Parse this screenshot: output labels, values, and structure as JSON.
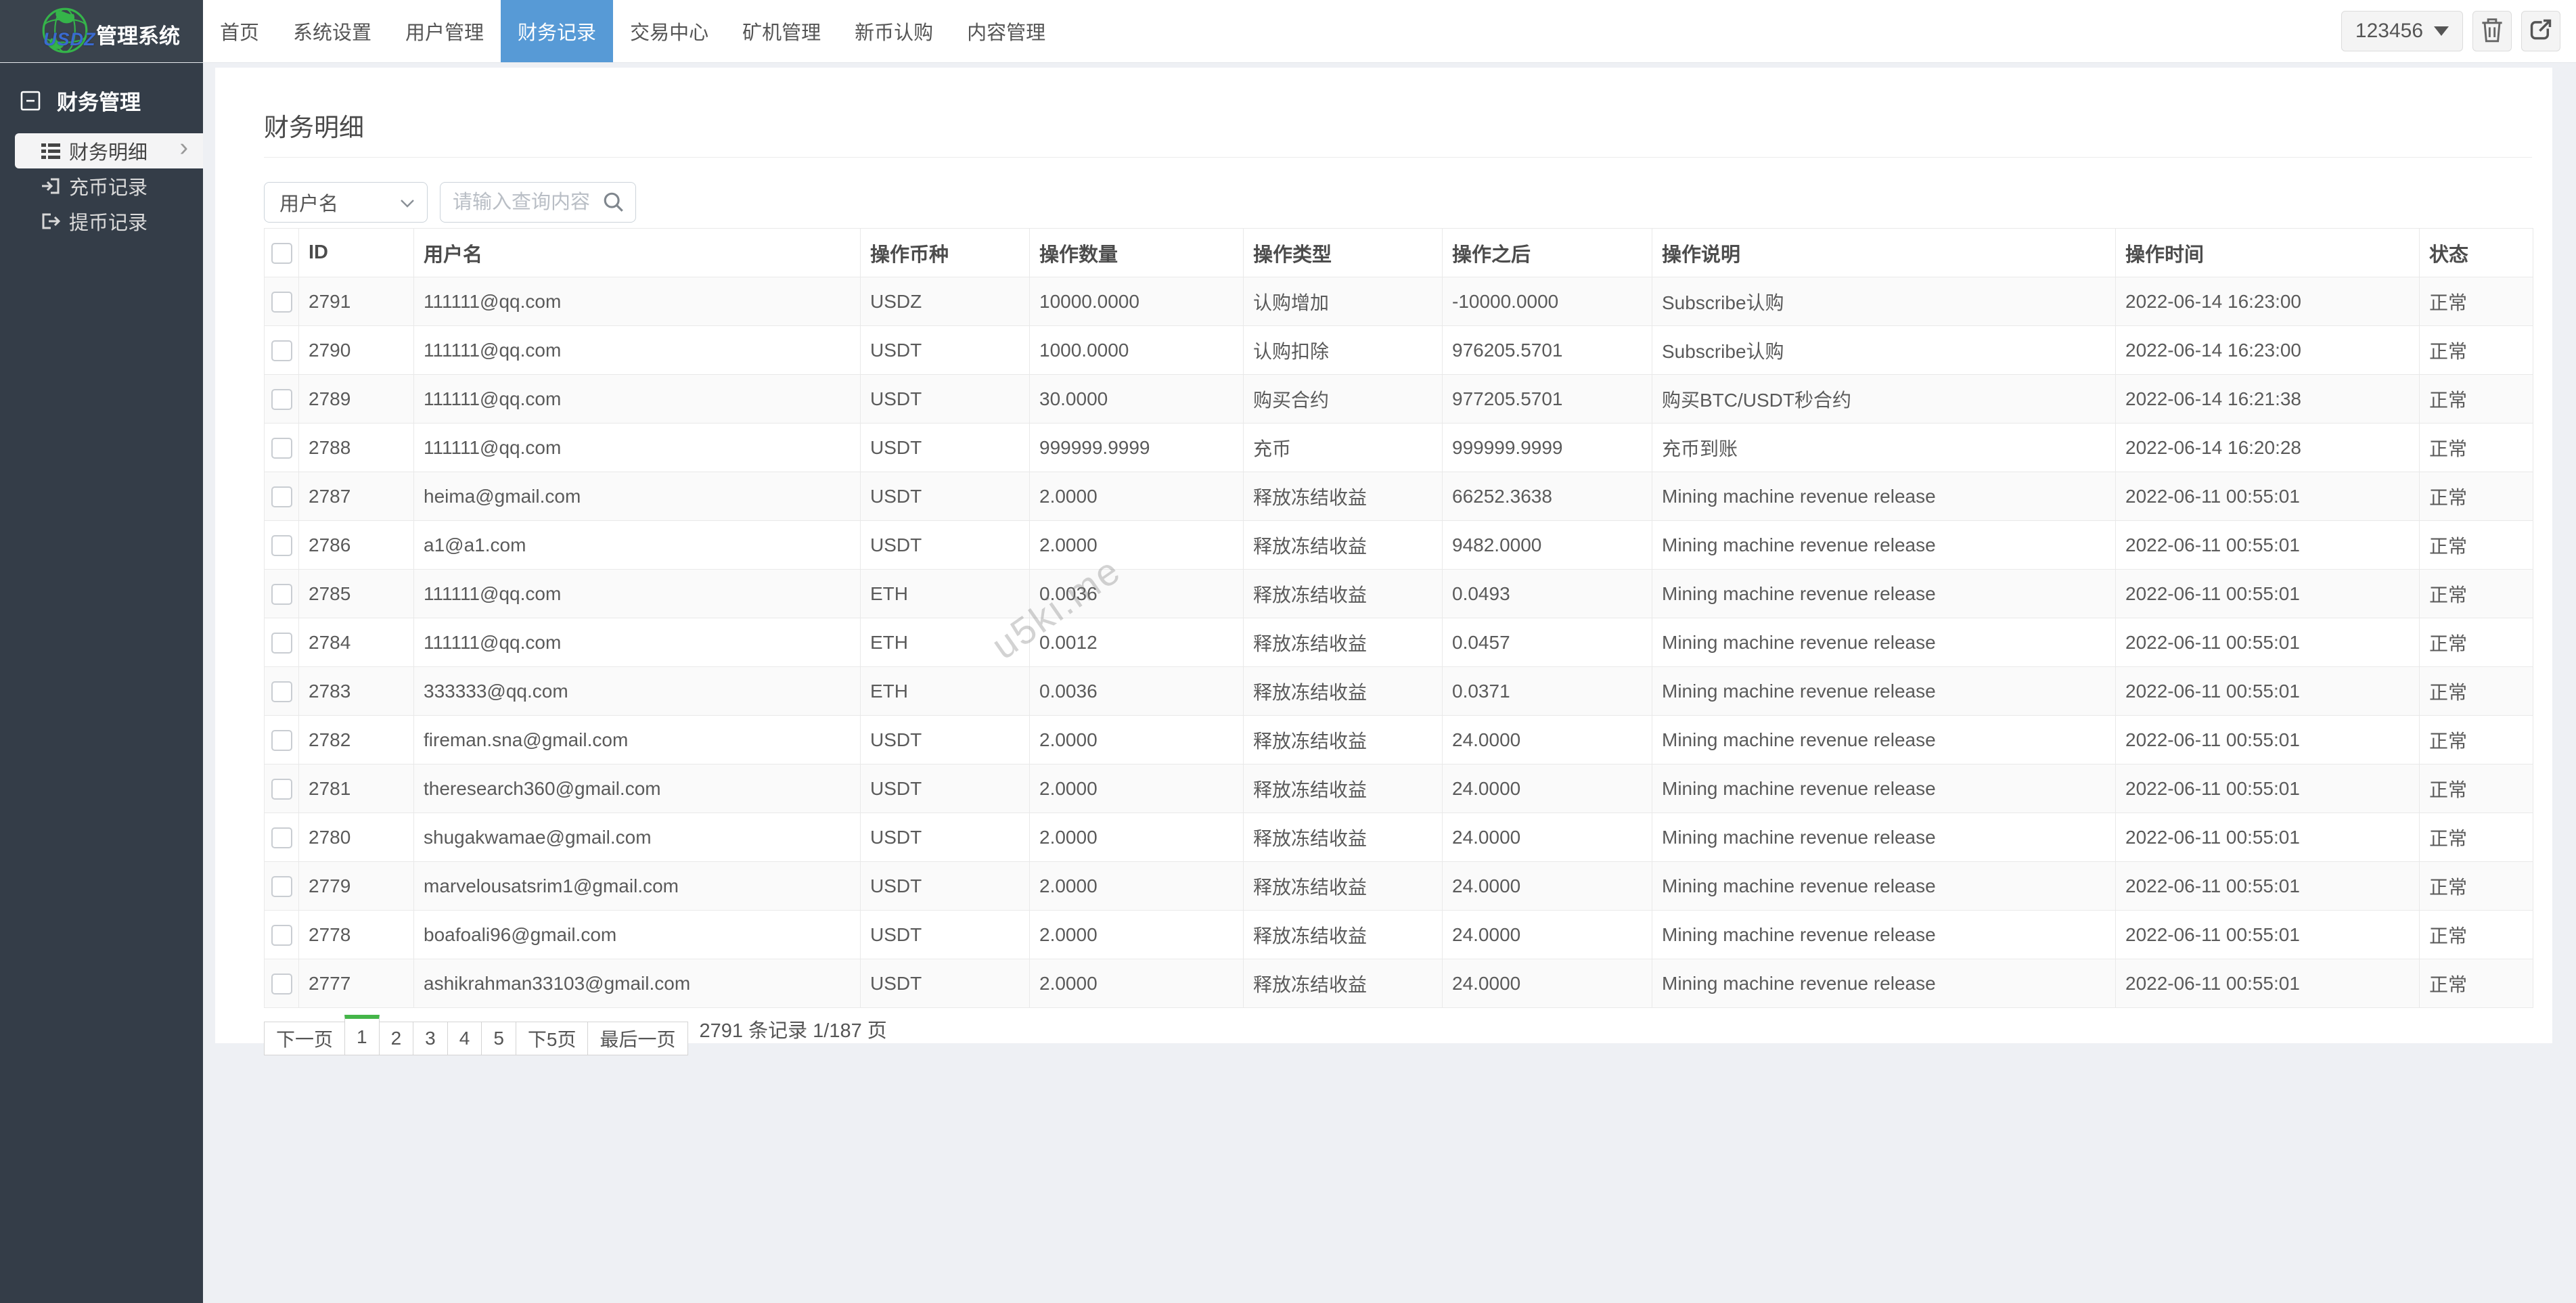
{
  "navbar": {
    "brand": {
      "logo_text": "USDZ",
      "title": "管理系统"
    },
    "items": [
      {
        "name": "home",
        "label": "首页",
        "active": false
      },
      {
        "name": "system-settings",
        "label": "系统设置",
        "active": false
      },
      {
        "name": "user-management",
        "label": "用户管理",
        "active": false
      },
      {
        "name": "finance-records",
        "label": "财务记录",
        "active": true
      },
      {
        "name": "trade-center",
        "label": "交易中心",
        "active": false
      },
      {
        "name": "miner-management",
        "label": "矿机管理",
        "active": false
      },
      {
        "name": "new-coin-subscription",
        "label": "新币认购",
        "active": false
      },
      {
        "name": "content-management",
        "label": "内容管理",
        "active": false
      }
    ],
    "user_button": "123456",
    "action_icons": [
      "trash-icon",
      "export-icon"
    ]
  },
  "sidebar": {
    "section": "财务管理",
    "items": [
      {
        "name": "finance-detail",
        "label": "财务明细",
        "icon": "list",
        "active": true
      },
      {
        "name": "deposit-records",
        "label": "充币记录",
        "icon": "sign-in",
        "active": false
      },
      {
        "name": "withdraw-records",
        "label": "提币记录",
        "icon": "sign-out",
        "active": false
      }
    ]
  },
  "main": {
    "title": "财务明细",
    "filter": {
      "field_select": "用户名",
      "search_placeholder": "请输入查询内容",
      "search_icon": "search-icon"
    },
    "table": {
      "columns": [
        "ID",
        "用户名",
        "操作币种",
        "操作数量",
        "操作类型",
        "操作之后",
        "操作说明",
        "操作时间",
        "状态"
      ],
      "rows": [
        [
          "2791",
          "111111@qq.com",
          "USDZ",
          "10000.0000",
          "认购增加",
          "-10000.0000",
          "Subscribe认购",
          "2022-06-14 16:23:00",
          "正常"
        ],
        [
          "2790",
          "111111@qq.com",
          "USDT",
          "1000.0000",
          "认购扣除",
          "976205.5701",
          "Subscribe认购",
          "2022-06-14 16:23:00",
          "正常"
        ],
        [
          "2789",
          "111111@qq.com",
          "USDT",
          "30.0000",
          "购买合约",
          "977205.5701",
          "购买BTC/USDT秒合约",
          "2022-06-14 16:21:38",
          "正常"
        ],
        [
          "2788",
          "111111@qq.com",
          "USDT",
          "999999.9999",
          "充币",
          "999999.9999",
          "充币到账",
          "2022-06-14 16:20:28",
          "正常"
        ],
        [
          "2787",
          "heima@gmail.com",
          "USDT",
          "2.0000",
          "释放冻结收益",
          "66252.3638",
          "Mining machine revenue release",
          "2022-06-11 00:55:01",
          "正常"
        ],
        [
          "2786",
          "a1@a1.com",
          "USDT",
          "2.0000",
          "释放冻结收益",
          "9482.0000",
          "Mining machine revenue release",
          "2022-06-11 00:55:01",
          "正常"
        ],
        [
          "2785",
          "111111@qq.com",
          "ETH",
          "0.0036",
          "释放冻结收益",
          "0.0493",
          "Mining machine revenue release",
          "2022-06-11 00:55:01",
          "正常"
        ],
        [
          "2784",
          "111111@qq.com",
          "ETH",
          "0.0012",
          "释放冻结收益",
          "0.0457",
          "Mining machine revenue release",
          "2022-06-11 00:55:01",
          "正常"
        ],
        [
          "2783",
          "333333@qq.com",
          "ETH",
          "0.0036",
          "释放冻结收益",
          "0.0371",
          "Mining machine revenue release",
          "2022-06-11 00:55:01",
          "正常"
        ],
        [
          "2782",
          "fireman.sna@gmail.com",
          "USDT",
          "2.0000",
          "释放冻结收益",
          "24.0000",
          "Mining machine revenue release",
          "2022-06-11 00:55:01",
          "正常"
        ],
        [
          "2781",
          "theresearch360@gmail.com",
          "USDT",
          "2.0000",
          "释放冻结收益",
          "24.0000",
          "Mining machine revenue release",
          "2022-06-11 00:55:01",
          "正常"
        ],
        [
          "2780",
          "shugakwamae@gmail.com",
          "USDT",
          "2.0000",
          "释放冻结收益",
          "24.0000",
          "Mining machine revenue release",
          "2022-06-11 00:55:01",
          "正常"
        ],
        [
          "2779",
          "marvelousatsrim1@gmail.com",
          "USDT",
          "2.0000",
          "释放冻结收益",
          "24.0000",
          "Mining machine revenue release",
          "2022-06-11 00:55:01",
          "正常"
        ],
        [
          "2778",
          "boafoali96@gmail.com",
          "USDT",
          "2.0000",
          "释放冻结收益",
          "24.0000",
          "Mining machine revenue release",
          "2022-06-11 00:55:01",
          "正常"
        ],
        [
          "2777",
          "ashikrahman33103@gmail.com",
          "USDT",
          "2.0000",
          "释放冻结收益",
          "24.0000",
          "Mining machine revenue release",
          "2022-06-11 00:55:01",
          "正常"
        ]
      ]
    },
    "pagination": {
      "buttons": [
        {
          "name": "next-page",
          "label": "下一页",
          "active": false
        },
        {
          "name": "page-1",
          "label": "1",
          "active": true
        },
        {
          "name": "page-2",
          "label": "2",
          "active": false
        },
        {
          "name": "page-3",
          "label": "3",
          "active": false
        },
        {
          "name": "page-4",
          "label": "4",
          "active": false
        },
        {
          "name": "page-5",
          "label": "5",
          "active": false
        },
        {
          "name": "next-5-pages",
          "label": "下5页",
          "active": false
        },
        {
          "name": "last-page",
          "label": "最后一页",
          "active": false
        }
      ],
      "summary": "2791 条记录 1/187 页"
    },
    "watermark": "u5ki.me"
  },
  "colors": {
    "accent_blue": "#579ad6",
    "active_page_green": "#44b549",
    "navbar_dark": "#3a434d",
    "sidebar_dark": "#343d48"
  }
}
